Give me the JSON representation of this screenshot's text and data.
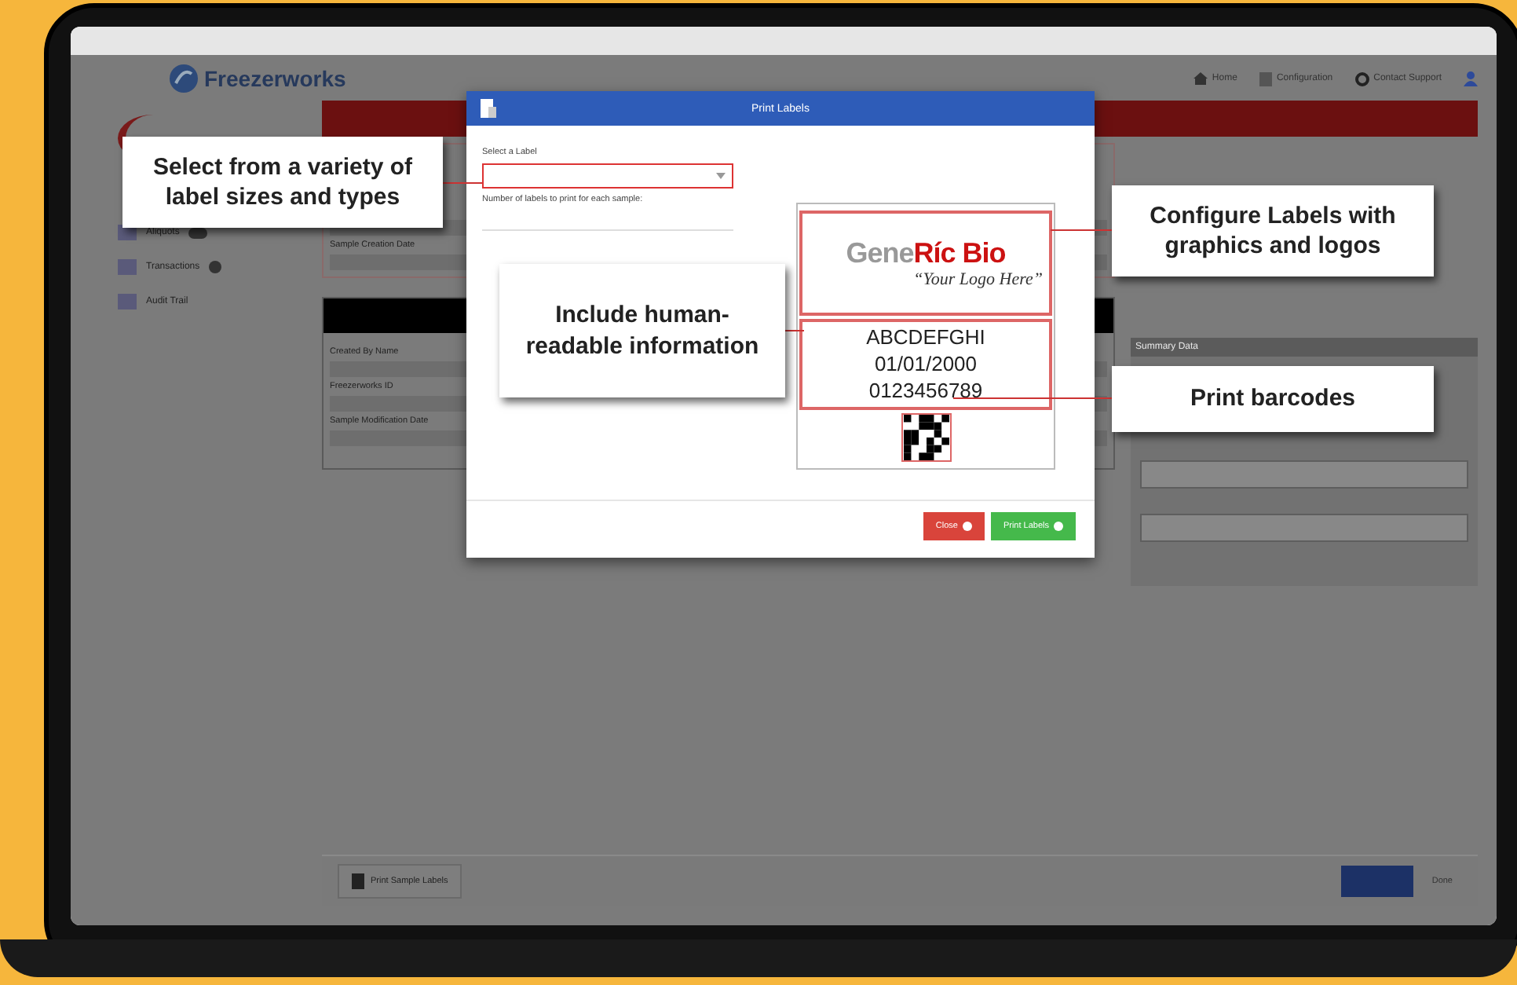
{
  "app": {
    "logo": "Freezerworks",
    "nav": [
      {
        "label": "Home",
        "kind": "home"
      },
      {
        "label": "Configuration",
        "kind": "config"
      },
      {
        "label": "Contact Support",
        "kind": "support"
      }
    ],
    "sidebar": [
      {
        "label": "Aliquots",
        "kind": "pill"
      },
      {
        "label": "Transactions",
        "kind": "dot"
      },
      {
        "label": "Audit Trail",
        "kind": "none"
      }
    ],
    "top_fields": [
      {
        "label": "Sample Creation Date"
      }
    ],
    "detail_fields": [
      {
        "label": "Created By Name"
      },
      {
        "label": "Freezerworks ID"
      },
      {
        "label": "Sample Modification Date"
      }
    ],
    "summary_title": "Summary Data",
    "footer": {
      "print_button": "Print Sample Labels",
      "done_button": "Done"
    }
  },
  "dialog": {
    "title": "Print Labels",
    "select_label": "Select a Label",
    "count_label": "Number of labels to print for each sample:",
    "preview": {
      "logo_gray": "Gene",
      "logo_red": "Ríc Bio",
      "tagline": "“Your Logo Here”",
      "lines": [
        "ABCDEFGHI",
        "01/01/2000",
        "0123456789"
      ]
    },
    "buttons": [
      {
        "label": "Close",
        "kind": "danger"
      },
      {
        "label": "Print Labels",
        "kind": "success"
      }
    ]
  },
  "callouts": [
    {
      "text": "Select from a variety of label sizes and types"
    },
    {
      "text": "Include human-readable information"
    },
    {
      "text": "Configure Labels with graphics and logos"
    },
    {
      "text": "Print barcodes"
    }
  ]
}
